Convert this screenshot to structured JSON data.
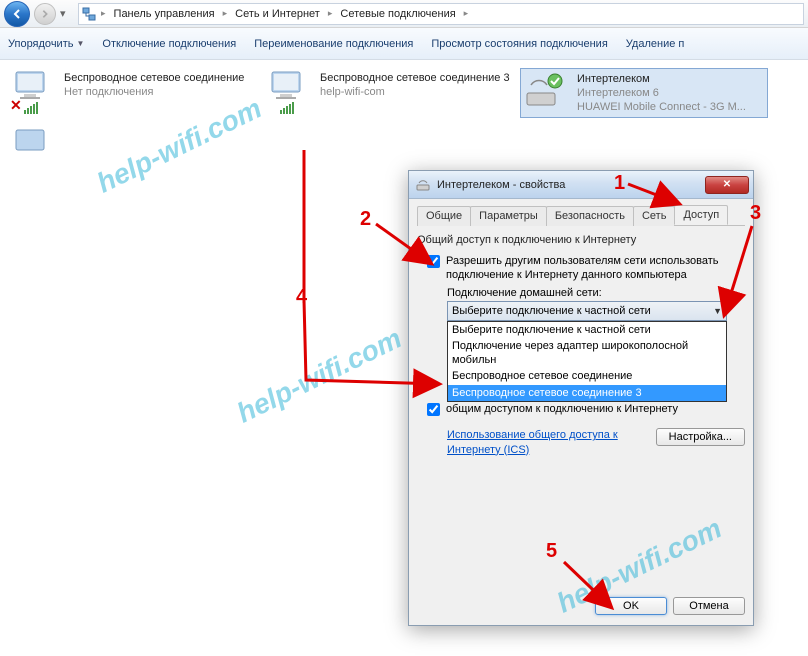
{
  "breadcrumb": {
    "items": [
      "Панель управления",
      "Сеть и Интернет",
      "Сетевые подключения"
    ]
  },
  "toolbar": {
    "organize": "Упорядочить",
    "disable": "Отключение подключения",
    "rename": "Переименование подключения",
    "status": "Просмотр состояния подключения",
    "delete": "Удаление п"
  },
  "connections": [
    {
      "name": "Беспроводное сетевое соединение",
      "sub1": "Нет подключения",
      "has_x": true
    },
    {
      "name": "Беспроводное сетевое соединение 3",
      "sub1": "help-wifi-com",
      "has_x": false
    },
    {
      "name": "Интертелеком",
      "sub1": "Интертелеком 6",
      "sub2": "HUAWEI Mobile Connect - 3G M...",
      "has_x": false,
      "type": "dialup"
    }
  ],
  "dialog": {
    "title": "Интертелеком - свойства",
    "tabs": {
      "general": "Общие",
      "params": "Параметры",
      "security": "Безопасность",
      "network": "Сеть",
      "access": "Доступ"
    },
    "section_title": "Общий доступ к подключению к Интернету",
    "chk1": "Разрешить другим пользователям сети использовать подключение к Интернету данного компьютера",
    "home_net_label": "Подключение домашней сети:",
    "combo_value": "Выберите подключение к частной сети",
    "combo_options": [
      "Выберите подключение к частной сети",
      "Подключение через адаптер широкополосной мобильн",
      "Беспроводное сетевое соединение",
      "Беспроводное сетевое соединение 3"
    ],
    "chk2_partial": "общим доступом к подключению к Интернету",
    "ics_link": "Использование общего доступа к Интернету (ICS)",
    "settings_btn": "Настройка...",
    "ok": "OK",
    "cancel": "Отмена"
  },
  "annotations": {
    "n1": "1",
    "n2": "2",
    "n3": "3",
    "n4": "4",
    "n5": "5"
  },
  "watermark": "help-wifi.com"
}
